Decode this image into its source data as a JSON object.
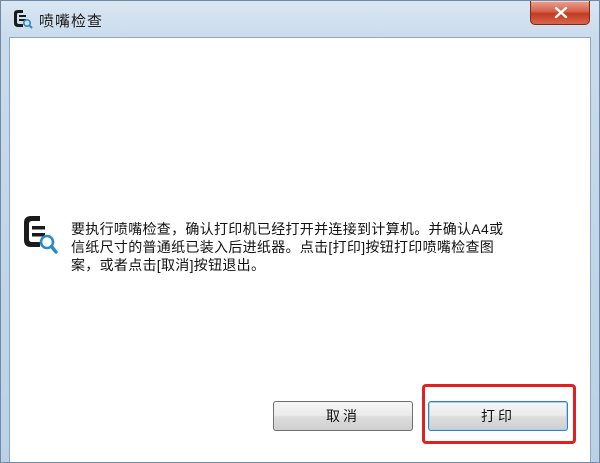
{
  "window": {
    "title": "喷嘴检查",
    "icon": "printer-head-icon",
    "close_icon": "close-icon"
  },
  "content": {
    "message_icon": "printer-nozzle-icon",
    "message_lines": [
      "要执行喷嘴检查，确认打印机已经打开并连接到计算机。并确认A4或",
      "信纸尺寸的普通纸已装入后进纸器。点击[打印]按钮打印喷嘴检查图",
      "案，或者点击[取消]按钮退出。"
    ]
  },
  "buttons": {
    "cancel_label": "取消",
    "print_label": "打印"
  },
  "colors": {
    "highlight": "#e0211f",
    "close_button": "#c23b22",
    "title_gradient_top": "#dbe7f3"
  }
}
